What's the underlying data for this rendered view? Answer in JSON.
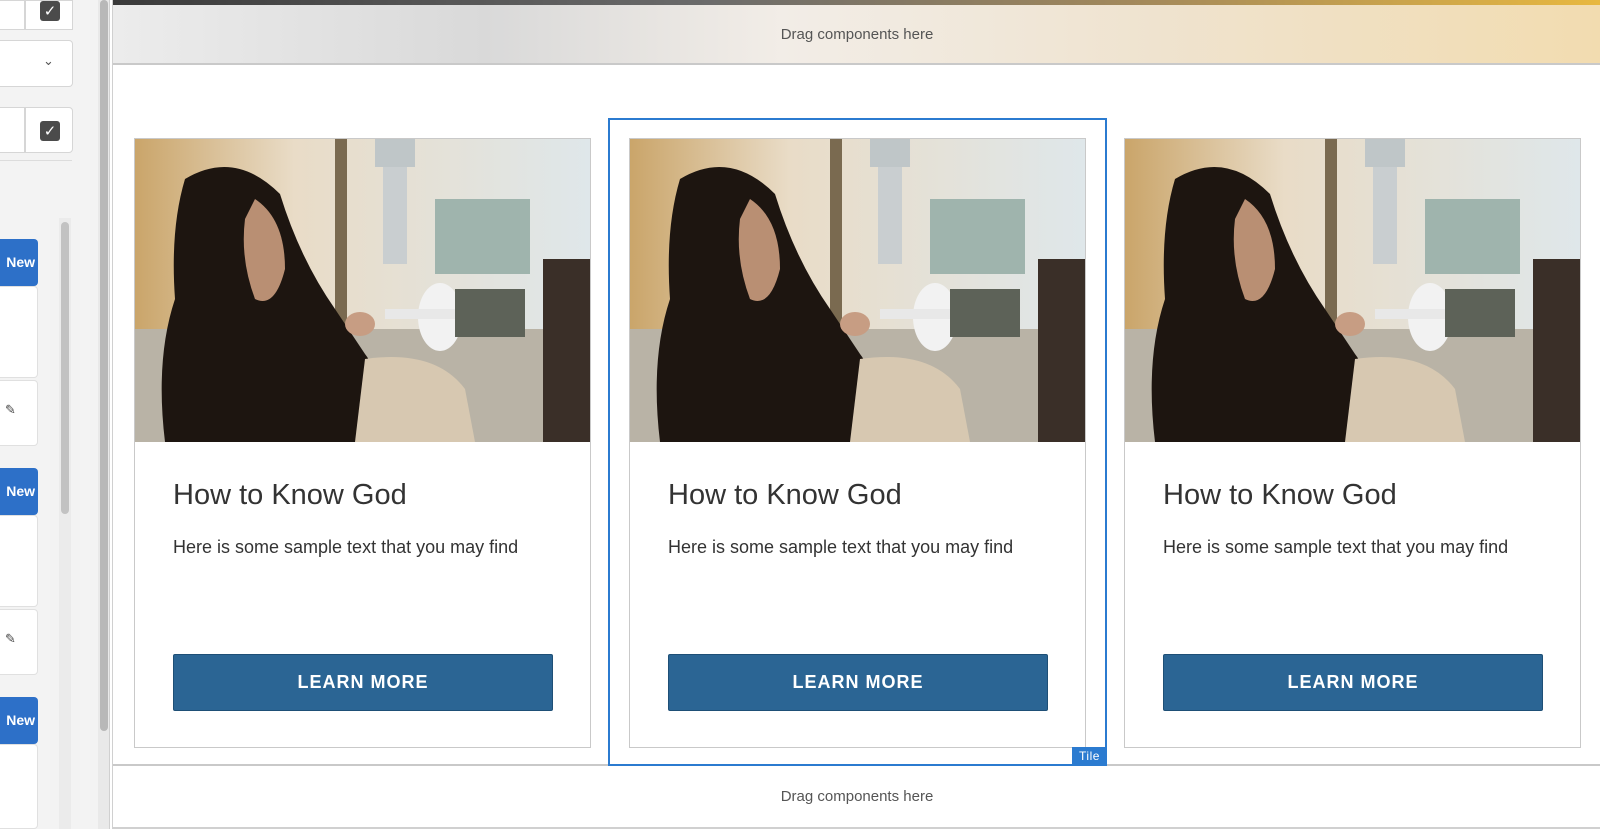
{
  "editor": {
    "drop_zone_top": "Drag components here",
    "drop_zone_bottom": "Drag components here",
    "selected_label": "Tile"
  },
  "sidebar": {
    "new_buttons": [
      "New",
      "New",
      "New"
    ],
    "icons": [
      "checkbox-checked-icon",
      "chevron-down-icon",
      "checkbox-checked-icon",
      "pencil-icon",
      "pencil-icon"
    ]
  },
  "tiles": [
    {
      "title": "How to Know God",
      "text": "Here is some sample text that you may find",
      "button": "LEARN MORE",
      "image": "woman-with-phone-at-airport"
    },
    {
      "title": "How to Know God",
      "text": "Here is some sample text that you may find",
      "button": "LEARN MORE",
      "image": "woman-with-phone-at-airport"
    },
    {
      "title": "How to Know God",
      "text": "Here is some sample text that you may find",
      "button": "LEARN MORE",
      "image": "woman-with-phone-at-airport"
    }
  ],
  "colors": {
    "button": "#2b6594",
    "selection": "#2b7bd0",
    "new_button": "#2d70c8"
  }
}
